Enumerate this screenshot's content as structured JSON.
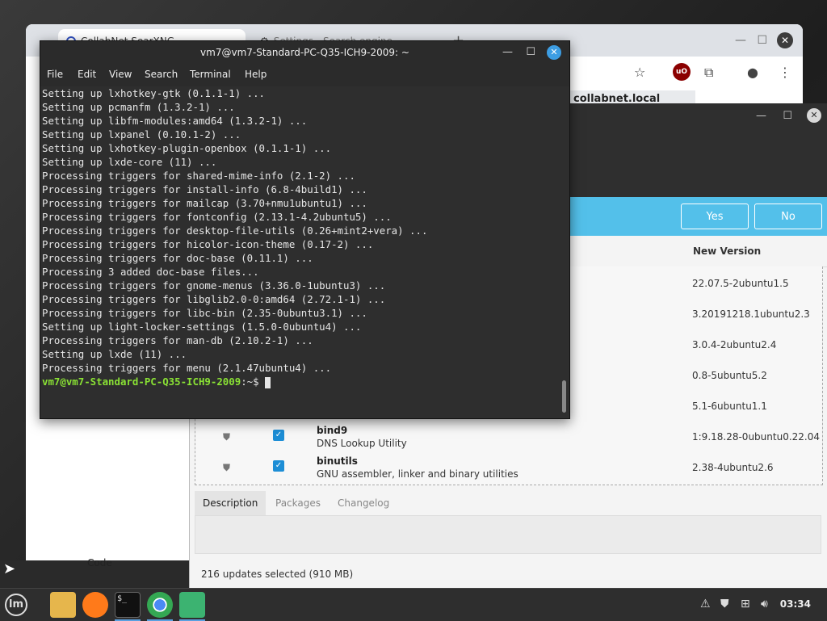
{
  "browser": {
    "tab_active": "CollabNet SearXNG",
    "tab_inactive": "Settings - Search engine",
    "url_fragment": "collabnet.local",
    "sidebar_label": "Code"
  },
  "update_manager": {
    "btn_yes": "Yes",
    "btn_no": "No",
    "col_new_version": "New Version",
    "rows": [
      {
        "name": "",
        "desc": "",
        "version": "22.07.5-2ubuntu1.5"
      },
      {
        "name": "",
        "desc": "",
        "version": "3.20191218.1ubuntu2.3"
      },
      {
        "name": "",
        "desc": "",
        "version": "3.0.4-2ubuntu2.4"
      },
      {
        "name": "",
        "desc": "",
        "version": "0.8-5ubuntu5.2"
      },
      {
        "name": "",
        "desc": "",
        "version": "5.1-6ubuntu1.1"
      },
      {
        "name": "bind9",
        "desc": "DNS Lookup Utility",
        "version": "1:9.18.28-0ubuntu0.22.04"
      },
      {
        "name": "binutils",
        "desc": "GNU assembler, linker and binary utilities",
        "version": "2.38-4ubuntu2.6"
      }
    ],
    "tabs": [
      "Description",
      "Packages",
      "Changelog"
    ],
    "status": "216 updates selected (910 MB)"
  },
  "terminal": {
    "title": "vm7@vm7-Standard-PC-Q35-ICH9-2009: ~",
    "menu": [
      "File",
      "Edit",
      "View",
      "Search",
      "Terminal",
      "Help"
    ],
    "lines": [
      "Setting up lxhotkey-gtk (0.1.1-1) ...",
      "Setting up pcmanfm (1.3.2-1) ...",
      "Setting up libfm-modules:amd64 (1.3.2-1) ...",
      "Setting up lxpanel (0.10.1-2) ...",
      "Setting up lxhotkey-plugin-openbox (0.1.1-1) ...",
      "Setting up lxde-core (11) ...",
      "Processing triggers for shared-mime-info (2.1-2) ...",
      "Processing triggers for install-info (6.8-4build1) ...",
      "Processing triggers for mailcap (3.70+nmu1ubuntu1) ...",
      "Processing triggers for fontconfig (2.13.1-4.2ubuntu5) ...",
      "Processing triggers for desktop-file-utils (0.26+mint2+vera) ...",
      "Processing triggers for hicolor-icon-theme (0.17-2) ...",
      "Processing triggers for doc-base (0.11.1) ...",
      "Processing 3 added doc-base files...",
      "Processing triggers for gnome-menus (3.36.0-1ubuntu3) ...",
      "Processing triggers for libglib2.0-0:amd64 (2.72.1-1) ...",
      "Processing triggers for libc-bin (2.35-0ubuntu3.1) ...",
      "Setting up light-locker-settings (1.5.0-0ubuntu4) ...",
      "Processing triggers for man-db (2.10.2-1) ...",
      "Setting up lxde (11) ...",
      "Processing triggers for menu (2.1.47ubuntu4) ..."
    ],
    "prompt_user": "vm7@vm7-Standard-PC-Q35-ICH9-2009",
    "prompt_suffix": ":~$ "
  },
  "taskbar": {
    "clock": "03:34"
  },
  "colors": {
    "accent": "#53c0ea",
    "prompt_green": "#8ae234",
    "close_blue": "#3d9ee4"
  }
}
